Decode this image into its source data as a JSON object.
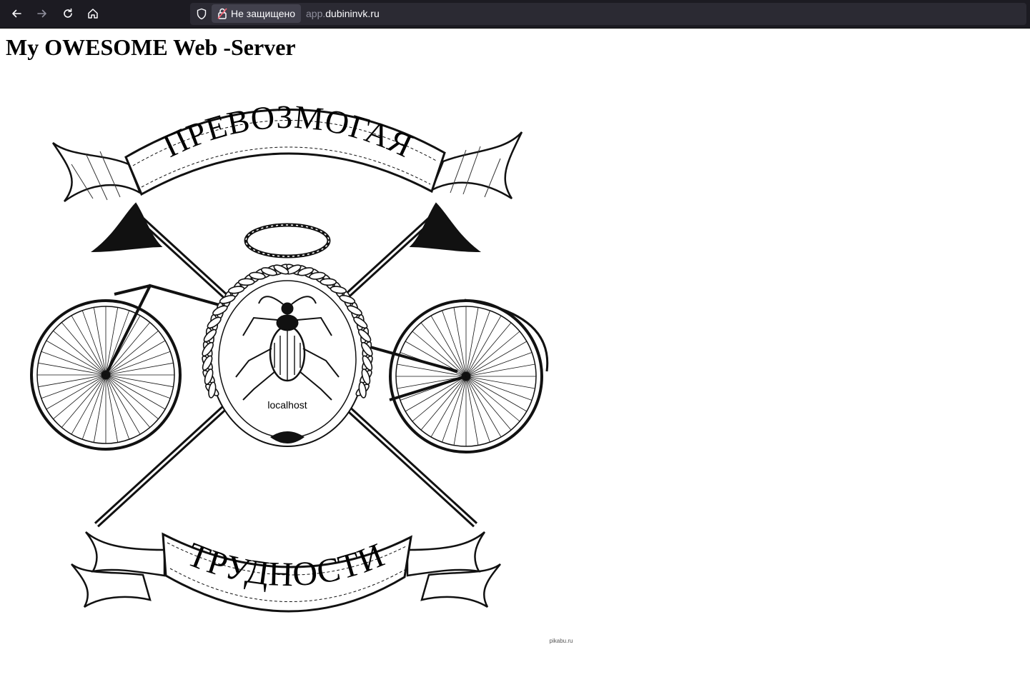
{
  "browser": {
    "back_icon": "arrow-left-icon",
    "forward_icon": "arrow-right-icon",
    "reload_icon": "reload-icon",
    "home_icon": "home-icon",
    "tracking_icon": "shield-icon",
    "security_label": "Не защищено",
    "url_subdomain": "app.",
    "url_domain": "dubininvk.ru",
    "toolbar_color": "#1c1b22",
    "urlbar_color": "#2b2a33",
    "text_color": "#fbfbfe"
  },
  "page": {
    "title": "My OWESOME Web -Server",
    "image": {
      "banner_top": "ПРЕВОЗМОГАЯ",
      "banner_bottom": "ТРУДНОСТИ",
      "center_label": "localhost",
      "watermark": "pikabu.ru"
    }
  }
}
